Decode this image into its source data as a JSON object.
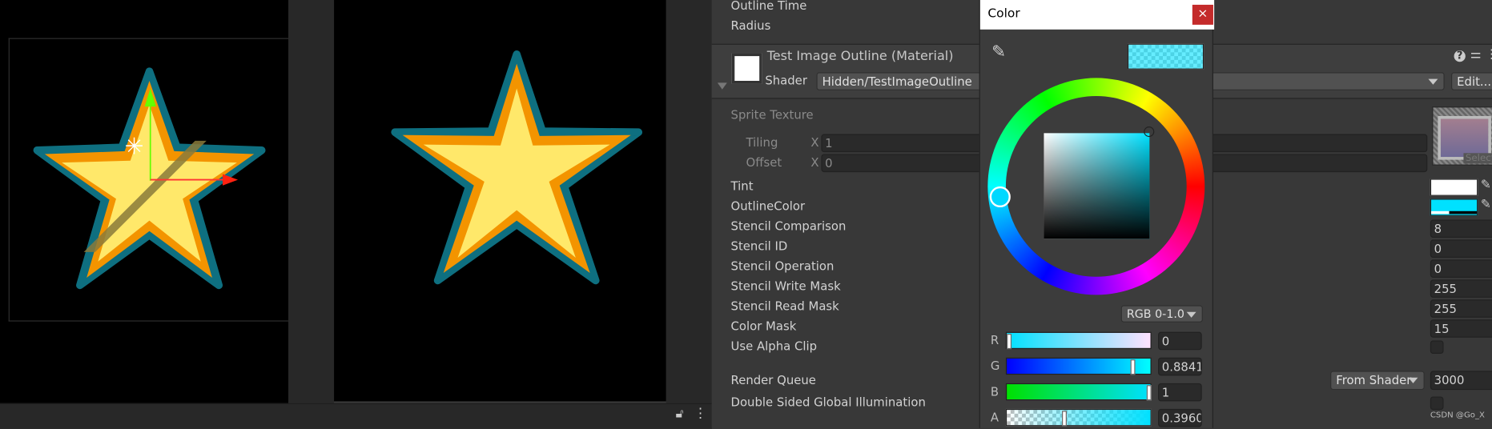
{
  "inspector": {
    "props_top": [
      "Outline Time",
      "Radius"
    ],
    "material": {
      "title": "Test Image Outline (Material)",
      "shader_label": "Shader",
      "shader_value": "Hidden/TestImageOutline",
      "edit_button": "Edit...",
      "icons": [
        "help-icon",
        "preset-icon",
        "more-icon"
      ]
    },
    "sprite_texture": {
      "label": "Sprite Texture",
      "tiling_label": "Tiling",
      "offset_label": "Offset",
      "x_label": "X",
      "tiling_x": "1",
      "offset_x": "0",
      "select_label": "Select"
    },
    "properties": [
      {
        "label": "Tint",
        "type": "color",
        "color": "#ffffff"
      },
      {
        "label": "OutlineColor",
        "type": "color",
        "color": "#00e1ff",
        "alpha": 0.396
      },
      {
        "label": "Stencil Comparison",
        "value": "8"
      },
      {
        "label": "Stencil ID",
        "value": "0"
      },
      {
        "label": "Stencil Operation",
        "value": "0"
      },
      {
        "label": "Stencil Write Mask",
        "value": "255"
      },
      {
        "label": "Stencil Read Mask",
        "value": "255"
      },
      {
        "label": "Color Mask",
        "value": "15"
      },
      {
        "label": "Use Alpha Clip",
        "type": "checkbox",
        "checked": false
      }
    ],
    "render_queue": {
      "label": "Render Queue",
      "mode": "From Shader",
      "value": "3000"
    },
    "double_sided": {
      "label": "Double Sided Global Illumination",
      "checked": false
    },
    "watermark": "CSDN @Go_X"
  },
  "color_picker": {
    "title": "Color",
    "close": "×",
    "mode": "RGB 0-1.0",
    "preview_color": "#00e1ff",
    "channels": [
      {
        "label": "R",
        "value": "0",
        "fraction": 0
      },
      {
        "label": "G",
        "value": "0.8841",
        "fraction": 0.8841
      },
      {
        "label": "B",
        "value": "1",
        "fraction": 1
      },
      {
        "label": "A",
        "value": "0.3960",
        "fraction": 0.396
      }
    ]
  },
  "colors": {
    "star_fill": "#ffe86a",
    "star_border": "#f39400",
    "outline": "#0e6f80",
    "accent": "#00e1ff"
  }
}
